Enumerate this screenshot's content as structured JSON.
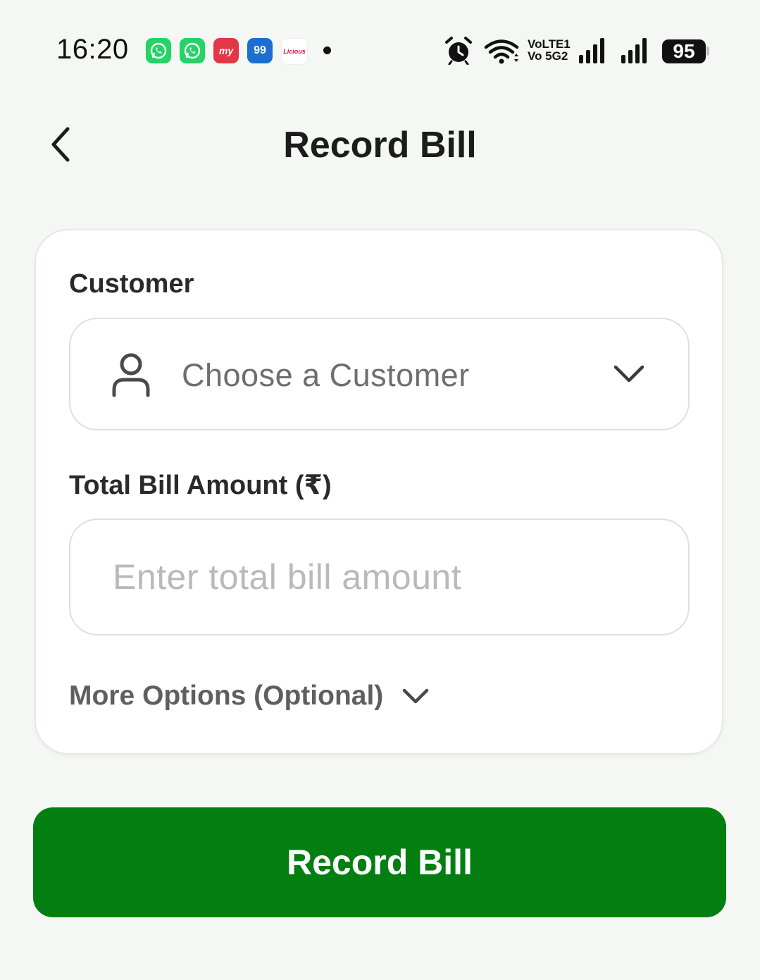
{
  "status_bar": {
    "time": "16:20",
    "notification_icons": [
      {
        "name": "whatsapp-icon",
        "text": "",
        "color": "#25d366"
      },
      {
        "name": "whatsapp-icon",
        "text": "",
        "color": "#25d366"
      },
      {
        "name": "bookmyshow-icon",
        "text": "my",
        "color": "#e23744"
      },
      {
        "name": "99acres-icon",
        "text": "99",
        "color": "#1a6fd1"
      },
      {
        "name": "licious-icon",
        "text": "Licious",
        "color": "#ffffff"
      }
    ],
    "network_label_top": "VoLTE1",
    "network_label_bottom": "Vo 5G2",
    "battery": "95"
  },
  "header": {
    "title": "Record Bill",
    "back_icon": "chevron-left-icon"
  },
  "form": {
    "customer": {
      "label": "Customer",
      "placeholder": "Choose a Customer",
      "icon": "user-icon",
      "dropdown_icon": "chevron-down-icon"
    },
    "amount": {
      "label": "Total Bill Amount (₹)",
      "placeholder": "Enter total bill amount",
      "value": ""
    },
    "more_options": {
      "label": "More Options (Optional)",
      "icon": "chevron-down-icon"
    }
  },
  "actions": {
    "submit_label": "Record Bill"
  },
  "colors": {
    "background": "#f4f7f4",
    "primary": "#027f10",
    "card": "#ffffff",
    "placeholder": "#b9b9b9"
  }
}
